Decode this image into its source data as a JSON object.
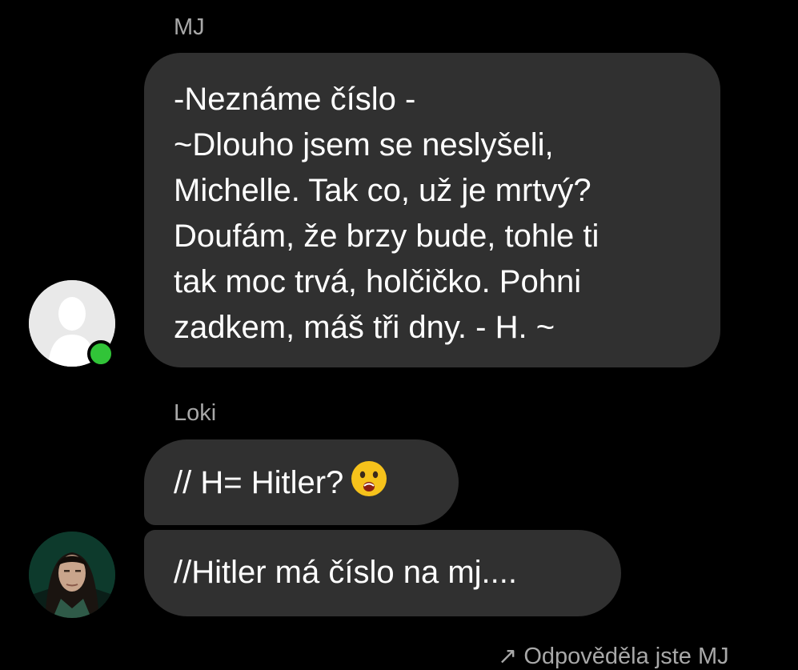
{
  "messages": [
    {
      "sender": "MJ",
      "bubbles": [
        {
          "lines": [
            "-Neznáme číslo -",
            "~Dlouho jsem se neslyšeli,",
            "Michelle. Tak co, už je mrtvý?",
            "Doufám, že brzy bude, tohle ti",
            "tak moc trvá, holčičko. Pohni",
            "zadkem, máš tři dny. - H. ~"
          ]
        }
      ],
      "avatar": "default-user-avatar",
      "online": true
    },
    {
      "sender": "Loki",
      "bubbles": [
        {
          "text": "// H= Hitler?",
          "emoji": "frowning-face-emoji"
        },
        {
          "text": "//Hitler má číslo na mj...."
        }
      ],
      "avatar": "loki-photo-avatar",
      "online": false
    }
  ],
  "footer": {
    "reply_hint": "↗ Odpověděla jste MJ"
  },
  "colors": {
    "background": "#000000",
    "bubble": "#303030",
    "sender_name": "#a8a8a8",
    "online_dot": "#31c438"
  }
}
